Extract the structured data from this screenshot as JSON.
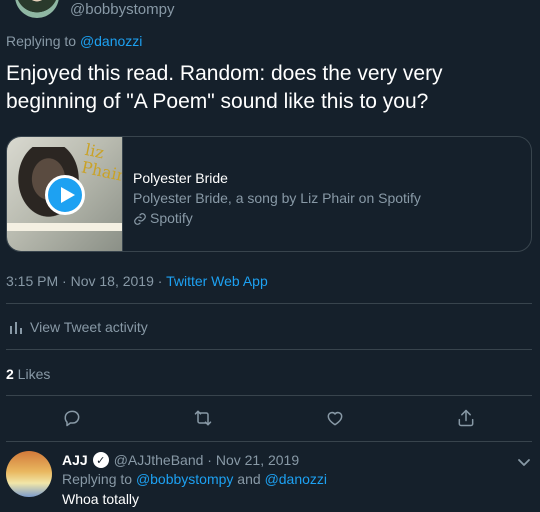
{
  "top_tweet": {
    "handle": "@bobbystompy",
    "replying_prefix": "Replying to ",
    "replying_to": "@danozzi",
    "text": "Enjoyed this read. Random: does the very very beginning of \"A Poem\" sound like this to you?"
  },
  "card": {
    "thumb_title": "liz Phair",
    "title": "Polyester Bride",
    "description": "Polyester Bride, a song by Liz Phair on Spotify",
    "source": "Spotify"
  },
  "meta": {
    "time_date": "3:15 PM · Nov 18, 2019 · ",
    "app": "Twitter Web App"
  },
  "activity": {
    "label": "View Tweet activity"
  },
  "likes": {
    "count": "2",
    "label": " Likes"
  },
  "actions": [
    "reply-icon",
    "retweet-icon",
    "like-icon",
    "share-icon"
  ],
  "reply": {
    "name": "AJJ",
    "handle_date": "@AJJtheBand · Nov 21, 2019",
    "replying_prefix": "Replying to ",
    "replying_user1": "@bobbystompy",
    "replying_and": " and ",
    "replying_user2": "@danozzi",
    "text": "Whoa totally"
  },
  "colors": {
    "background": "#15202b",
    "accent": "#1da1f2",
    "muted": "#8899a6",
    "border": "#38444d"
  }
}
